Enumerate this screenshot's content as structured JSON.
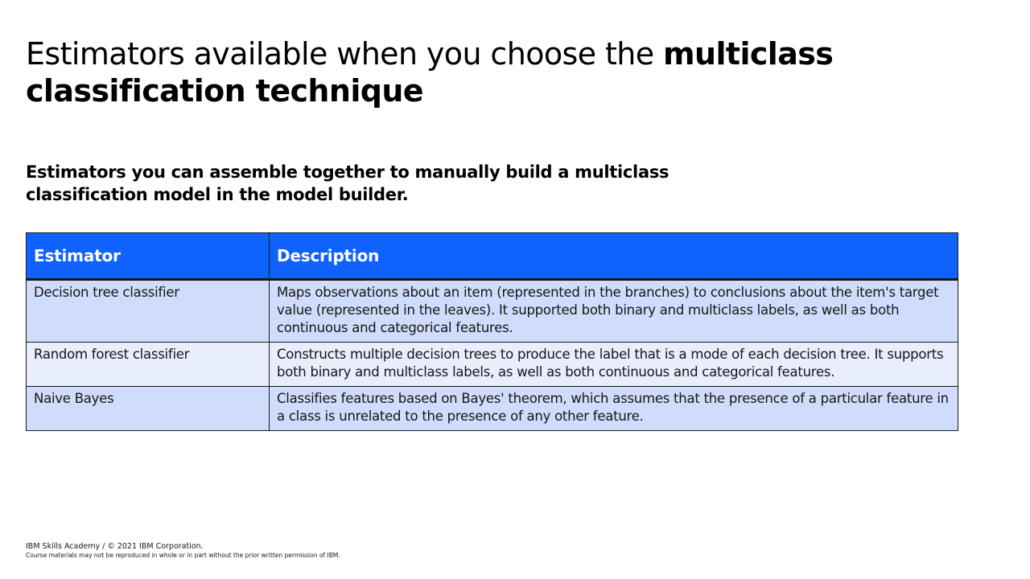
{
  "title": {
    "normal": "Estimators available when you choose the ",
    "bold": "multiclass classification technique"
  },
  "subtitle": "Estimators you can assemble together to manually build a multiclass classification model in the model builder.",
  "table": {
    "headers": [
      "Estimator",
      "Description"
    ],
    "rows": [
      {
        "estimator": "Decision tree classifier",
        "description": "Maps observations about an item (represented in the branches) to conclusions about the item's target value (represented in the leaves). It supported both binary and multiclass labels, as well as both continuous and categorical features."
      },
      {
        "estimator": "Random forest classifier",
        "description": "Constructs multiple decision trees to produce the label that is a mode of each decision tree. It supports both binary and multiclass labels, as well as both continuous and categorical features."
      },
      {
        "estimator": "Naive Bayes",
        "description": "Classifies features based on Bayes' theorem, which assumes that the presence of a particular feature in a class is unrelated to the presence of any other feature."
      }
    ]
  },
  "footer": {
    "copyright": "IBM Skills Academy / © 2021 IBM Corporation.",
    "notice": "Course materials may not be reproduced in whole or in part without the prior written permission of IBM."
  },
  "colors": {
    "header_bg": "#0f62fe",
    "row_dark": "#d0dcfb",
    "row_light": "#e9eefd"
  }
}
